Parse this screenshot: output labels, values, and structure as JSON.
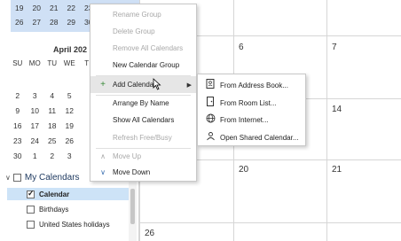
{
  "mini_calendar": {
    "prev_rows": [
      [
        "19",
        "20",
        "21",
        "22",
        "23"
      ],
      [
        "26",
        "27",
        "28",
        "29",
        "30"
      ]
    ],
    "month_title": "April 202",
    "dow": [
      "SU",
      "MO",
      "TU",
      "WE",
      "T"
    ],
    "rows": [
      [
        "2",
        "3",
        "4",
        "5",
        ""
      ],
      [
        "9",
        "10",
        "11",
        "12",
        ""
      ],
      [
        "16",
        "17",
        "18",
        "19",
        ""
      ],
      [
        "23",
        "24",
        "25",
        "26",
        ""
      ],
      [
        "30",
        "1",
        "2",
        "3",
        ""
      ]
    ]
  },
  "my_calendars": {
    "header": "My Calendars",
    "items": [
      {
        "label": "Calendar",
        "checked": true,
        "selected": true
      },
      {
        "label": "Birthdays",
        "checked": false,
        "selected": false
      },
      {
        "label": "United States holidays",
        "checked": false,
        "selected": false
      }
    ]
  },
  "grid": {
    "day_numbers": [
      "6",
      "7",
      "14",
      "20",
      "21",
      "26"
    ]
  },
  "context_menu": {
    "items": [
      {
        "label": "Rename Group",
        "disabled": true
      },
      {
        "label": "Delete Group",
        "disabled": true
      },
      {
        "label": "Remove All Calendars",
        "disabled": true
      },
      {
        "label": "New Calendar Group",
        "disabled": false
      },
      {
        "label": "Add Calendar",
        "disabled": false,
        "icon": "add-icon",
        "submenu": true
      },
      {
        "label": "Arrange By Name",
        "disabled": false
      },
      {
        "label": "Show All Calendars",
        "disabled": false
      },
      {
        "label": "Refresh Free/Busy",
        "disabled": true
      },
      {
        "label": "Move Up",
        "disabled": true,
        "icon": "chevron-up-icon"
      },
      {
        "label": "Move Down",
        "disabled": false,
        "icon": "chevron-down-icon"
      }
    ]
  },
  "submenu": {
    "items": [
      {
        "label": "From Address Book...",
        "icon": "address-book-icon"
      },
      {
        "label": "From Room List...",
        "icon": "room-list-icon"
      },
      {
        "label": "From Internet...",
        "icon": "globe-icon"
      },
      {
        "label": "Open Shared Calendar...",
        "icon": "shared-calendar-icon"
      }
    ]
  },
  "colors": {
    "accent": "#3b6fb0",
    "selection": "#cde3f7",
    "minical_highlight": "#cfe0f5"
  }
}
